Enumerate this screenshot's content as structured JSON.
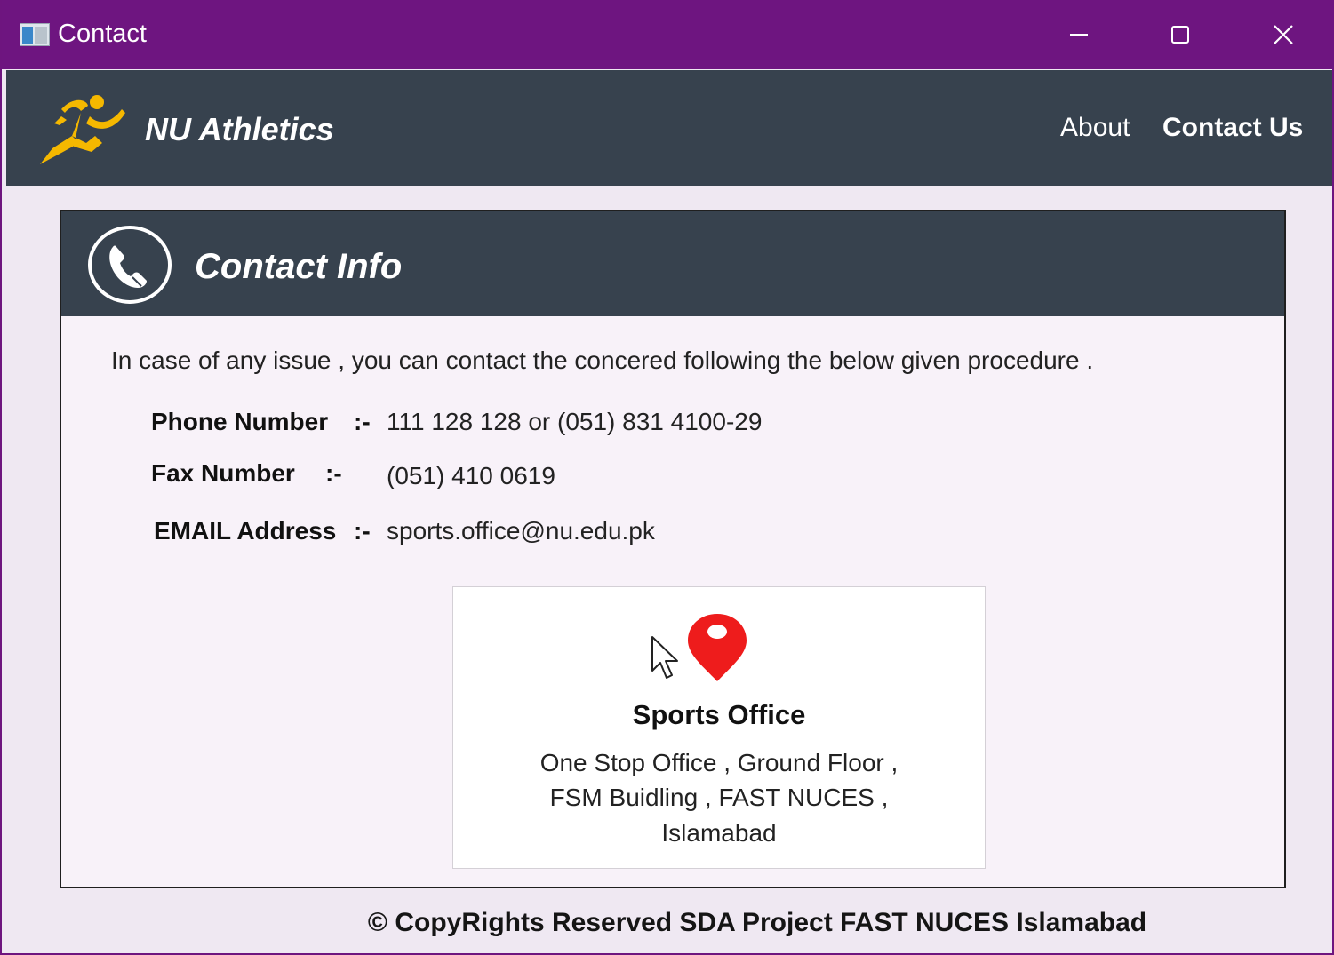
{
  "window": {
    "title": "Contact",
    "icon": "window-app-icon",
    "controls": {
      "minimize": "minimize-icon",
      "maximize": "maximize-icon",
      "close": "close-icon"
    }
  },
  "navbar": {
    "brand": "NU Athletics",
    "logo_icon": "runner-logo-icon",
    "links": {
      "about": "About",
      "contact": "Contact Us"
    }
  },
  "contact_card": {
    "title": "Contact Info",
    "icon": "phone-icon",
    "intro": "In case of any issue , you can contact the concered following the below given procedure .",
    "phone": {
      "label": "Phone Number",
      "sep": ":-",
      "value": "111 128 128 or (051) 831 4100-29"
    },
    "fax": {
      "label": "Fax Number",
      "sep": ":-",
      "value": "(051) 410 0619"
    },
    "email": {
      "label": "EMAIL Address",
      "sep": ":-",
      "value": "sports.office@nu.edu.pk"
    },
    "office": {
      "title": "Sports Office",
      "icon": "location-pin-icon",
      "address_lines": [
        "One Stop Office , Ground Floor ,",
        "FSM Buidling , FAST NUCES ,",
        "Islamabad"
      ]
    }
  },
  "footer": {
    "text": "© CopyRights Reserved SDA Project FAST NUCES Islamabad"
  },
  "colors": {
    "titlebar": "#6e1580",
    "navbar": "#37424e",
    "background": "#efe8f2",
    "pin": "#ee1c1c",
    "logo": "#f5b800"
  }
}
